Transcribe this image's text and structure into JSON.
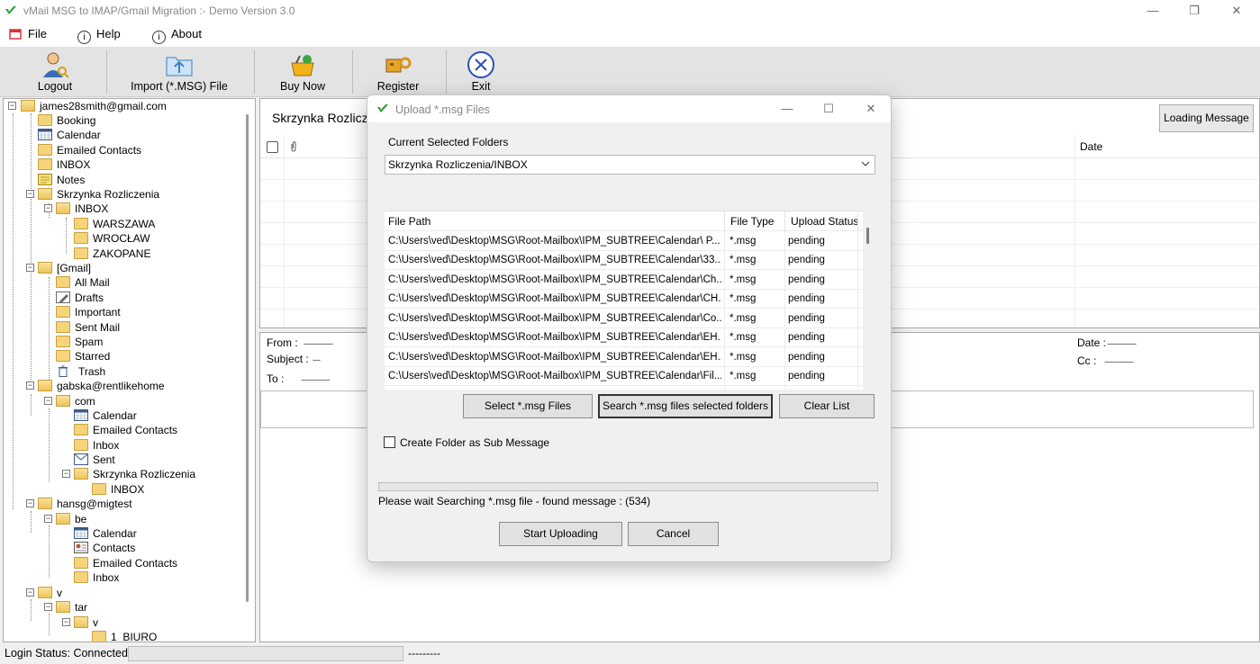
{
  "window": {
    "title": "vMail MSG to IMAP/Gmail Migration :- Demo Version 3.0",
    "controls": [
      "—",
      "❐",
      "✕"
    ]
  },
  "menu": {
    "file": "File",
    "help": "Help",
    "about": "About"
  },
  "toolbar": {
    "logout": "Logout",
    "import": "Import (*.MSG) File",
    "buy_now": "Buy Now",
    "register": "Register",
    "exit": "Exit"
  },
  "tree": {
    "account1": "james28smith@gmail.com",
    "booking": "Booking",
    "calendar": "Calendar",
    "emailed_contacts": "Emailed Contacts",
    "inbox_upper": "INBOX",
    "notes": "Notes",
    "skrzynka": "Skrzynka Rozliczenia",
    "warszawa": "WARSZAWA",
    "wroclaw": "WROCŁAW",
    "zakopane": "ZAKOPANE",
    "gmail": "[Gmail]",
    "all_mail": "All Mail",
    "drafts": "Drafts",
    "important": "Important",
    "sent_mail": "Sent Mail",
    "spam": "Spam",
    "starred": "Starred",
    "trash": "Trash",
    "account2": "gabska@rentlikehome",
    "com": "com",
    "inbox": "Inbox",
    "sent": "Sent",
    "account3": "hansg@migtest",
    "be": "be",
    "contacts": "Contacts",
    "v": "v",
    "tar": "tar",
    "biuro": "1_BIURO"
  },
  "mail": {
    "title": "Skrzynka Rozlicz",
    "loading_button": "Loading Message",
    "date_header": "Date"
  },
  "detail": {
    "from_label": "From :",
    "subject_label": "Subject :",
    "to_label": "To :",
    "date_label": "Date :",
    "cc_label": "Cc :",
    "from_value": "----------------",
    "subject_value": "----",
    "to_value": "----------------",
    "date_value": "----------------",
    "cc_value": "----------------"
  },
  "status": {
    "text": "Login Status: Connected",
    "dashes": "---------"
  },
  "dialog": {
    "title": "Upload *.msg Files",
    "current_label": "Current Selected Folders",
    "selected_folder": "Skrzynka Rozliczenia/INBOX",
    "col_path": "File Path",
    "col_type": "File Type",
    "col_status": "Upload Status",
    "rows": [
      {
        "path": "C:\\Users\\ved\\Desktop\\MSG\\Root-Mailbox\\IPM_SUBTREE\\Calendar\\  P...",
        "type": "*.msg",
        "status": "pending"
      },
      {
        "path": "C:\\Users\\ved\\Desktop\\MSG\\Root-Mailbox\\IPM_SUBTREE\\Calendar\\33...",
        "type": "*.msg",
        "status": "pending"
      },
      {
        "path": "C:\\Users\\ved\\Desktop\\MSG\\Root-Mailbox\\IPM_SUBTREE\\Calendar\\Ch...",
        "type": "*.msg",
        "status": "pending"
      },
      {
        "path": "C:\\Users\\ved\\Desktop\\MSG\\Root-Mailbox\\IPM_SUBTREE\\Calendar\\CH...",
        "type": "*.msg",
        "status": "pending"
      },
      {
        "path": "C:\\Users\\ved\\Desktop\\MSG\\Root-Mailbox\\IPM_SUBTREE\\Calendar\\Co...",
        "type": "*.msg",
        "status": "pending"
      },
      {
        "path": "C:\\Users\\ved\\Desktop\\MSG\\Root-Mailbox\\IPM_SUBTREE\\Calendar\\EH...",
        "type": "*.msg",
        "status": "pending"
      },
      {
        "path": "C:\\Users\\ved\\Desktop\\MSG\\Root-Mailbox\\IPM_SUBTREE\\Calendar\\EH...",
        "type": "*.msg",
        "status": "pending"
      },
      {
        "path": "C:\\Users\\ved\\Desktop\\MSG\\Root-Mailbox\\IPM_SUBTREE\\Calendar\\Fil...",
        "type": "*.msg",
        "status": "pending"
      }
    ],
    "select_button": "Select *.msg Files",
    "search_button": "Search *.msg files selected folders",
    "clear_button": "Clear List",
    "checkbox_label": "Create Folder as Sub Message",
    "progress_text": "Please wait Searching *.msg file - found message : (534)",
    "start_button": "Start Uploading",
    "cancel_button": "Cancel"
  },
  "colors": {
    "accent": "#2c6fbf",
    "folder": "#f5d47a",
    "dialog_bg": "#f0f0f0"
  }
}
